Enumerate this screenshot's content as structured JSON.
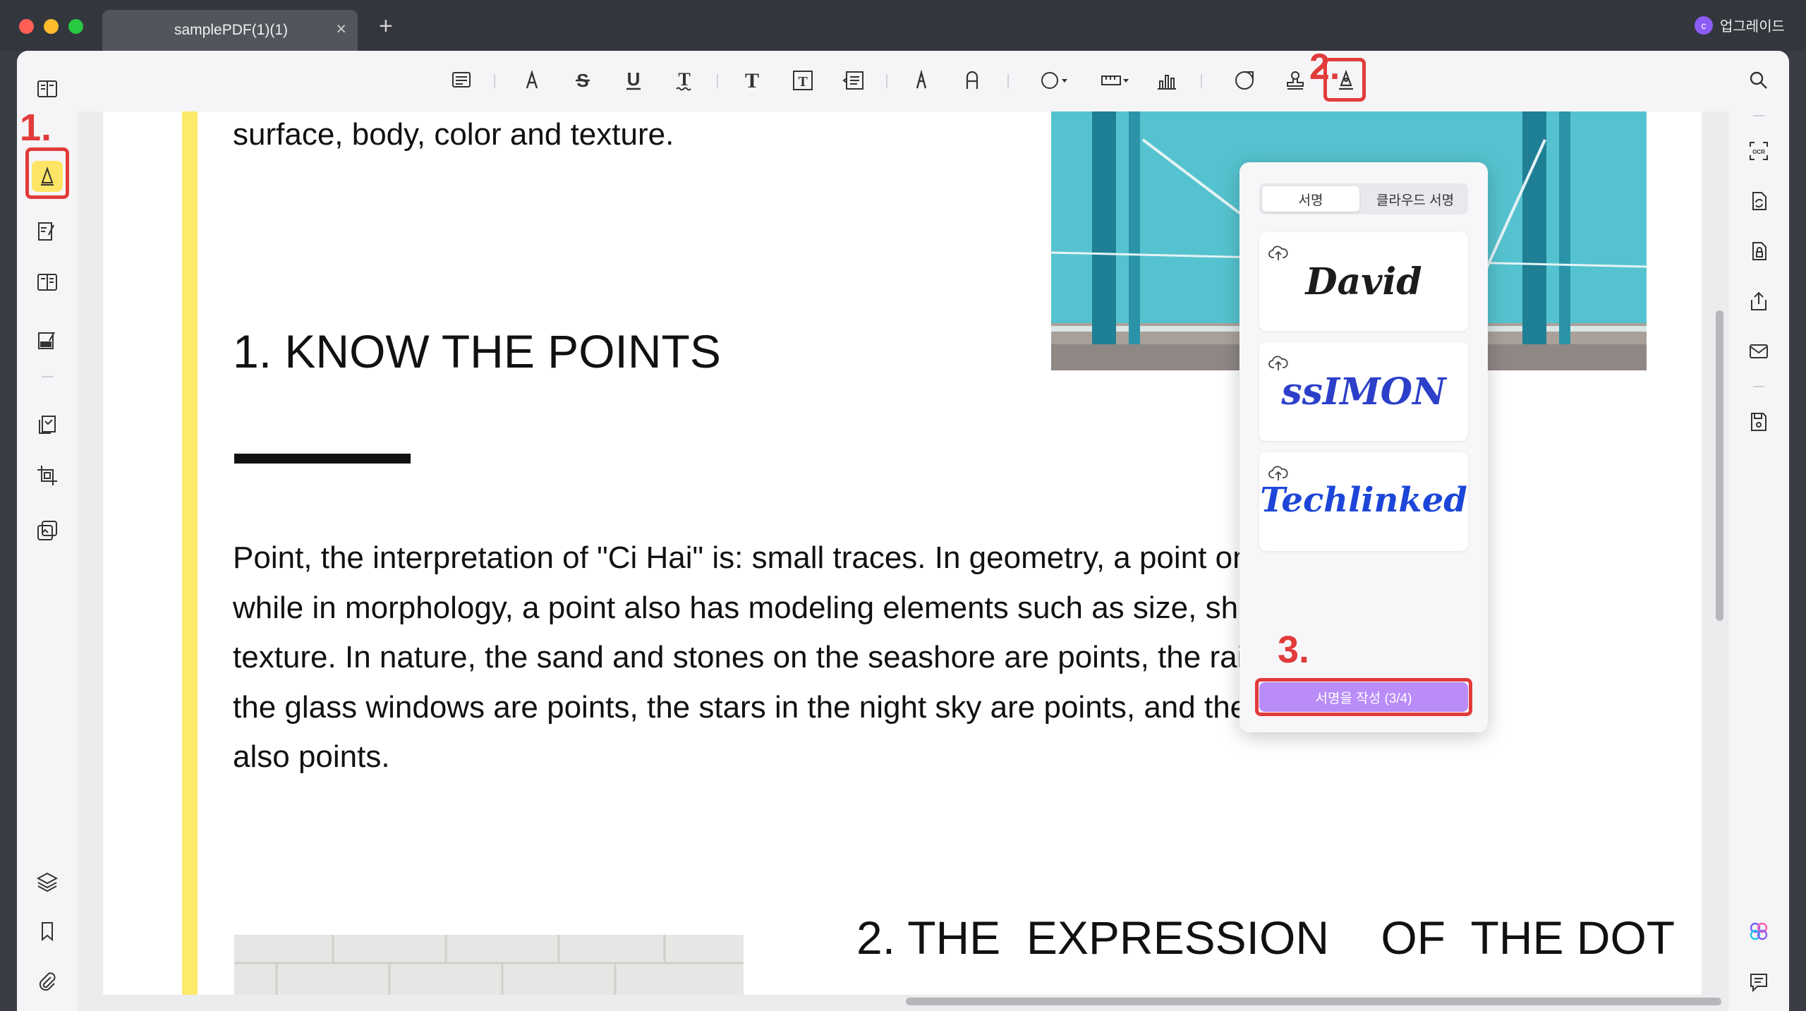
{
  "window": {
    "tab_title": "samplePDF(1)(1)",
    "tab_close": "×",
    "tab_add": "+",
    "upgrade_initial": "c",
    "upgrade_label": "업그레이드"
  },
  "annotations": {
    "step1": "1.",
    "step2": "2.",
    "step3": "3."
  },
  "document": {
    "top_line": "surface, body, color and texture.",
    "heading1": "1. KNOW THE POINTS",
    "paragraph_lines": [
      "Point, the interpretation of \"Ci Hai\" is: small traces. In geometry, a point only has position,",
      "while in morphology, a point also has modeling elements such as size, shape, color, and",
      "texture. In nature, the sand and stones on the seashore are points, the raindrops falling on",
      "the glass windows are points, the stars in the night sky are points, and the dust in the air is",
      "also points."
    ],
    "heading2": "2. THE  EXPRESSION    OF  THE DOT"
  },
  "signature_panel": {
    "tab_signature": "서명",
    "tab_cloud_signature": "클라우드 서명",
    "signatures": [
      {
        "text": "David",
        "color": "#1c1c1c"
      },
      {
        "text": "ssIMON",
        "color": "#2b3fc9"
      },
      {
        "text": "Techlinked",
        "color": "#1d46d8"
      }
    ],
    "create_button": "서명을 작성 (3/4)"
  },
  "colors": {
    "annotation_red": "#e23b3b",
    "active_tool_yellow": "#ffe566",
    "create_button_purple": "#b98cf8"
  },
  "icons": {
    "left_rail": [
      "reader-icon",
      "comment-highlight-icon",
      "edit-icon",
      "form-icon",
      "fill-sign-icon",
      "organize-pages-icon",
      "crop-icon",
      "tools-icon",
      "layers-icon",
      "bookmark-icon",
      "attachment-icon"
    ],
    "toolbar": [
      "note-icon",
      "highlighter-icon",
      "strikethrough-icon",
      "underline-icon",
      "squiggly-icon",
      "text-icon",
      "textbox-icon",
      "textcallout-icon",
      "pencil-icon",
      "eraser-icon",
      "shape-icon",
      "measure-icon",
      "chart-icon",
      "sticker-icon",
      "stamp-icon",
      "signature-icon"
    ],
    "right_rail": [
      "search-icon",
      "ocr-icon",
      "convert-icon",
      "protect-icon",
      "share-icon",
      "email-icon",
      "save-icon",
      "ai-icon",
      "comment-list-icon"
    ]
  }
}
